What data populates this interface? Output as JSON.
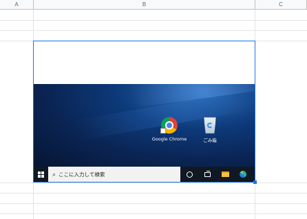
{
  "sheet": {
    "columns": [
      "A",
      "B",
      "C"
    ]
  },
  "desktop": {
    "icons": [
      {
        "label": "Google Chrome",
        "icon": "chrome-icon"
      },
      {
        "label": "ごみ箱",
        "icon": "recycle-bin-icon"
      }
    ],
    "taskbar": {
      "search_placeholder": "ここに入力して検索",
      "items": [
        "cortana-icon",
        "task-view-icon",
        "file-explorer-icon",
        "edge-icon"
      ]
    }
  },
  "colors": {
    "selection": "#1a73e8",
    "taskbar": "#101823",
    "desktop_dark": "#061634",
    "desktop_light": "#2a6bb8"
  }
}
